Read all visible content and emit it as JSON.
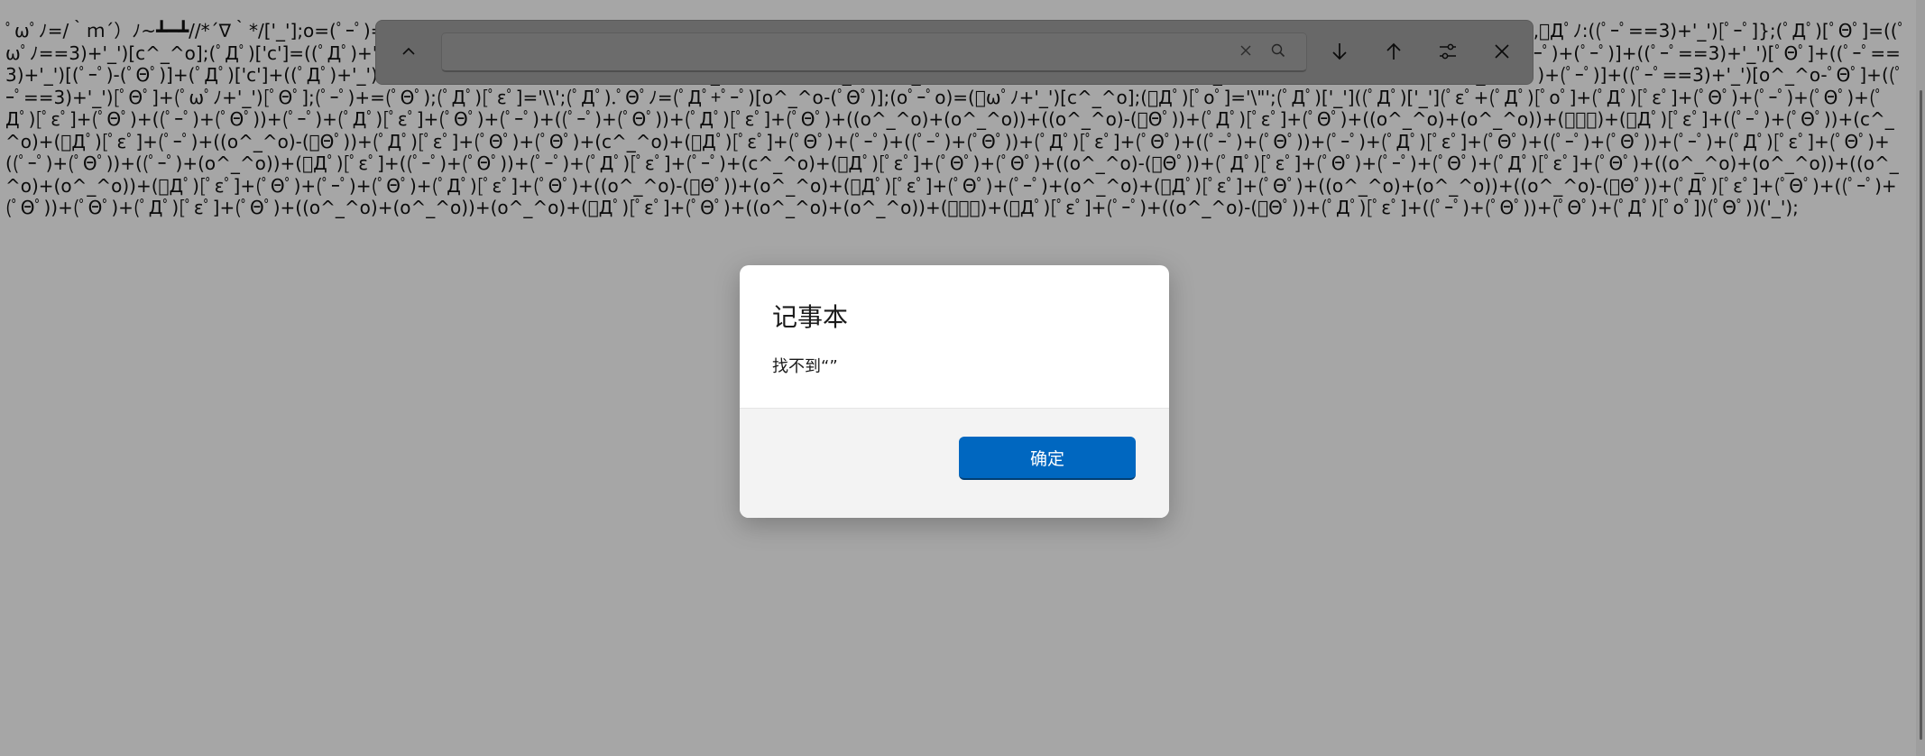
{
  "editor": {
    "content": "ﾟωﾟﾉ=/｀ｍ´）ﾉ~┻━┻//*´∇｀*/['_'];o=(ﾟｰﾟ)=_=3;c=(ﾟΘﾟ)=(ﾟｰﾟ)-(ﾟｰﾟ);(ﾟДﾟ)=(ﾟΘﾟ)=(o^_^o)/(o^_^o);(ﾟДﾟ)={ﾟΘﾟ:'_',ﾟωﾟﾉ:((ﾟωﾟﾉ==3)+'_')[ﾟΘﾟ],ﾟｰﾟﾉ:(ﾟωﾟﾉ+'_')[o^_^o-(ﾟΘﾟ)],ﾟДﾟﾉ:((ﾟｰﾟ==3)+'_')[ﾟｰﾟ]};(ﾟДﾟ)[ﾟΘﾟ]=((ﾟωﾟﾉ==3)+'_')[c^_^o];(ﾟДﾟ)['c']=((ﾟДﾟ)+'_')[(ﾟｰﾟ)+(ﾟｰﾟ)-(ﾟΘﾟ)];(ﾟДﾟ)['o']=((ﾟДﾟ)+'_')[ﾟΘﾟ];(ﾟoﾟ)=(ﾟДﾟ)['c']+(ﾟДﾟ)['o']+(ﾟωﾟﾉ+'_')[ﾟΘﾟ]+((ﾟωﾟﾉ==3)+'_')[ﾟｰﾟ]+((ﾟДﾟ)+'_')[(ﾟｰﾟ)+(ﾟｰﾟ)]+((ﾟｰﾟ==3)+'_')[ﾟΘﾟ]+((ﾟｰﾟ==3)+'_')[(ﾟｰﾟ)-(ﾟΘﾟ)]+(ﾟДﾟ)['c']+((ﾟДﾟ)+'_')[(ﾟｰﾟ)+(ﾟｰﾟ)]+(ﾟДﾟ)['o']+((ﾟｰﾟ==3)+'_')[ﾟΘﾟ];(ﾟДﾟ)['_']=(o^_^o)[ﾟoﾟ][ﾟoﾟ];(ﾟεﾟ)=((ﾟｰﾟ==3)+'_')[ﾟΘﾟ]+(ﾟДﾟ).ﾟДﾟﾉ+((ﾟДﾟ)+'_')[(ﾟｰﾟ)+(ﾟｰﾟ)]+((ﾟｰﾟ==3)+'_')[o^_^o-ﾟΘﾟ]+((ﾟｰﾟ==3)+'_')[ﾟΘﾟ]+(ﾟωﾟﾉ+'_')[ﾟΘﾟ];(ﾟｰﾟ)+=(ﾟΘﾟ);(ﾟДﾟ)[ﾟεﾟ]='\\\\';(ﾟДﾟ).ﾟΘﾟﾉ=(ﾟДﾟ+ﾟｰﾟ)[o^_^o-(ﾟΘﾟ)];(oﾟｰﾟo)=(ﾟωﾟﾉ+'_')[c^_^o];(ﾟДﾟ)[ﾟoﾟ]='\\\"';(ﾟДﾟ)['_']((ﾟДﾟ)['_'](ﾟεﾟ+(ﾟДﾟ)[ﾟoﾟ]+(ﾟДﾟ)[ﾟεﾟ]+(ﾟΘﾟ)+(ﾟｰﾟ)+(ﾟΘﾟ)+(ﾟДﾟ)[ﾟεﾟ]+(ﾟΘﾟ)+((ﾟｰﾟ)+(ﾟΘﾟ))+(ﾟｰﾟ)+(ﾟДﾟ)[ﾟεﾟ]+(ﾟΘﾟ)+(ﾟｰﾟ)+((ﾟｰﾟ)+(ﾟΘﾟ))+(ﾟДﾟ)[ﾟεﾟ]+(ﾟΘﾟ)+((o^_^o)+(o^_^o))+((o^_^o)-(ﾟΘﾟ))+(ﾟДﾟ)[ﾟεﾟ]+(ﾟΘﾟ)+((o^_^o)+(o^_^o))+(ﾟｰﾟ)+(ﾟДﾟ)[ﾟεﾟ]+((ﾟｰﾟ)+(ﾟΘﾟ))+(c^_^o)+(ﾟДﾟ)[ﾟεﾟ]+(ﾟｰﾟ)+((o^_^o)-(ﾟΘﾟ))+(ﾟДﾟ)[ﾟεﾟ]+(ﾟΘﾟ)+(ﾟΘﾟ)+(c^_^o)+(ﾟДﾟ)[ﾟεﾟ]+(ﾟΘﾟ)+(ﾟｰﾟ)+((ﾟｰﾟ)+(ﾟΘﾟ))+(ﾟДﾟ)[ﾟεﾟ]+(ﾟΘﾟ)+((ﾟｰﾟ)+(ﾟΘﾟ))+(ﾟｰﾟ)+(ﾟДﾟ)[ﾟεﾟ]+(ﾟΘﾟ)+((ﾟｰﾟ)+(ﾟΘﾟ))+(ﾟｰﾟ)+(ﾟДﾟ)[ﾟεﾟ]+(ﾟΘﾟ)+((ﾟｰﾟ)+(ﾟΘﾟ))+((ﾟｰﾟ)+(o^_^o))+(ﾟДﾟ)[ﾟεﾟ]+((ﾟｰﾟ)+(ﾟΘﾟ))+(ﾟｰﾟ)+(ﾟДﾟ)[ﾟεﾟ]+(ﾟｰﾟ)+(c^_^o)+(ﾟДﾟ)[ﾟεﾟ]+(ﾟΘﾟ)+(ﾟΘﾟ)+((o^_^o)-(ﾟΘﾟ))+(ﾟДﾟ)[ﾟεﾟ]+(ﾟΘﾟ)+(ﾟｰﾟ)+(ﾟΘﾟ)+(ﾟДﾟ)[ﾟεﾟ]+(ﾟΘﾟ)+((o^_^o)+(o^_^o))+((o^_^o)+(o^_^o))+(ﾟДﾟ)[ﾟεﾟ]+(ﾟΘﾟ)+(ﾟｰﾟ)+(ﾟΘﾟ)+(ﾟДﾟ)[ﾟεﾟ]+(ﾟΘﾟ)+((o^_^o)-(ﾟΘﾟ))+(o^_^o)+(ﾟДﾟ)[ﾟεﾟ]+(ﾟΘﾟ)+(ﾟｰﾟ)+(o^_^o)+(ﾟДﾟ)[ﾟεﾟ]+(ﾟΘﾟ)+((o^_^o)+(o^_^o))+((o^_^o)-(ﾟΘﾟ))+(ﾟДﾟ)[ﾟεﾟ]+(ﾟΘﾟ)+((ﾟｰﾟ)+(ﾟΘﾟ))+(ﾟΘﾟ)+(ﾟДﾟ)[ﾟεﾟ]+(ﾟΘﾟ)+((o^_^o)+(o^_^o))+(o^_^o)+(ﾟДﾟ)[ﾟεﾟ]+(ﾟΘﾟ)+((o^_^o)+(o^_^o))+(ﾟｰﾟ)+(ﾟДﾟ)[ﾟεﾟ]+(ﾟｰﾟ)+((o^_^o)-(ﾟΘﾟ))+(ﾟДﾟ)[ﾟεﾟ]+((ﾟｰﾟ)+(ﾟΘﾟ))+(ﾟΘﾟ)+(ﾟДﾟ)[ﾟoﾟ])(ﾟΘﾟ))('_');"
  },
  "find_bar": {
    "collapse_icon": "chevron-up-icon",
    "search_value": "",
    "search_placeholder": "",
    "clear_icon": "x-icon",
    "search_icon": "magnifier-icon",
    "next_icon": "arrow-down-icon",
    "prev_icon": "arrow-up-icon",
    "options_icon": "sliders-icon",
    "close_icon": "x-icon"
  },
  "dialog": {
    "title": "记事本",
    "message": "找不到“”",
    "ok_label": "确定"
  },
  "colors": {
    "accent": "#0067c0",
    "dim_overlay": "rgba(0,0,0,0.35)"
  }
}
